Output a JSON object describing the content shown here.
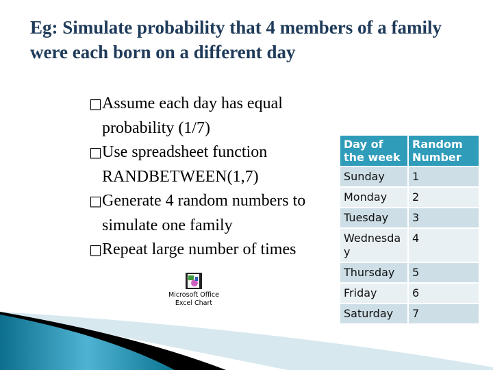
{
  "title": "Eg: Simulate probability that 4 members of a family were each born on a different day",
  "bullet_marker": "□",
  "bullets": [
    {
      "line1": "Assume each day has equal",
      "line2": "probability (1/7)"
    },
    {
      "line1": "Use spreadsheet function",
      "line2": "RANDBETWEEN(1,7)"
    },
    {
      "line1": "Generate 4 random numbers to",
      "line2": "simulate one family"
    },
    {
      "line1": "Repeat large number of times",
      "line2": ""
    }
  ],
  "table": {
    "headers": [
      "Day of the week",
      "Random Number"
    ],
    "rows": [
      [
        "Sunday",
        "1"
      ],
      [
        "Monday",
        "2"
      ],
      [
        "Tuesday",
        "3"
      ],
      [
        "Wednesday",
        "4"
      ],
      [
        "Thursday",
        "5"
      ],
      [
        "Friday",
        "6"
      ],
      [
        "Saturday",
        "7"
      ]
    ]
  },
  "embedded_object": {
    "label_line1": "Microsoft Office",
    "label_line2": "Excel Chart",
    "icon": "excel-chart-icon"
  },
  "colors": {
    "title": "#1f3b5a",
    "table_header": "#2f9cba",
    "row_odd": "#cddee6",
    "row_even": "#e8f0f3"
  }
}
